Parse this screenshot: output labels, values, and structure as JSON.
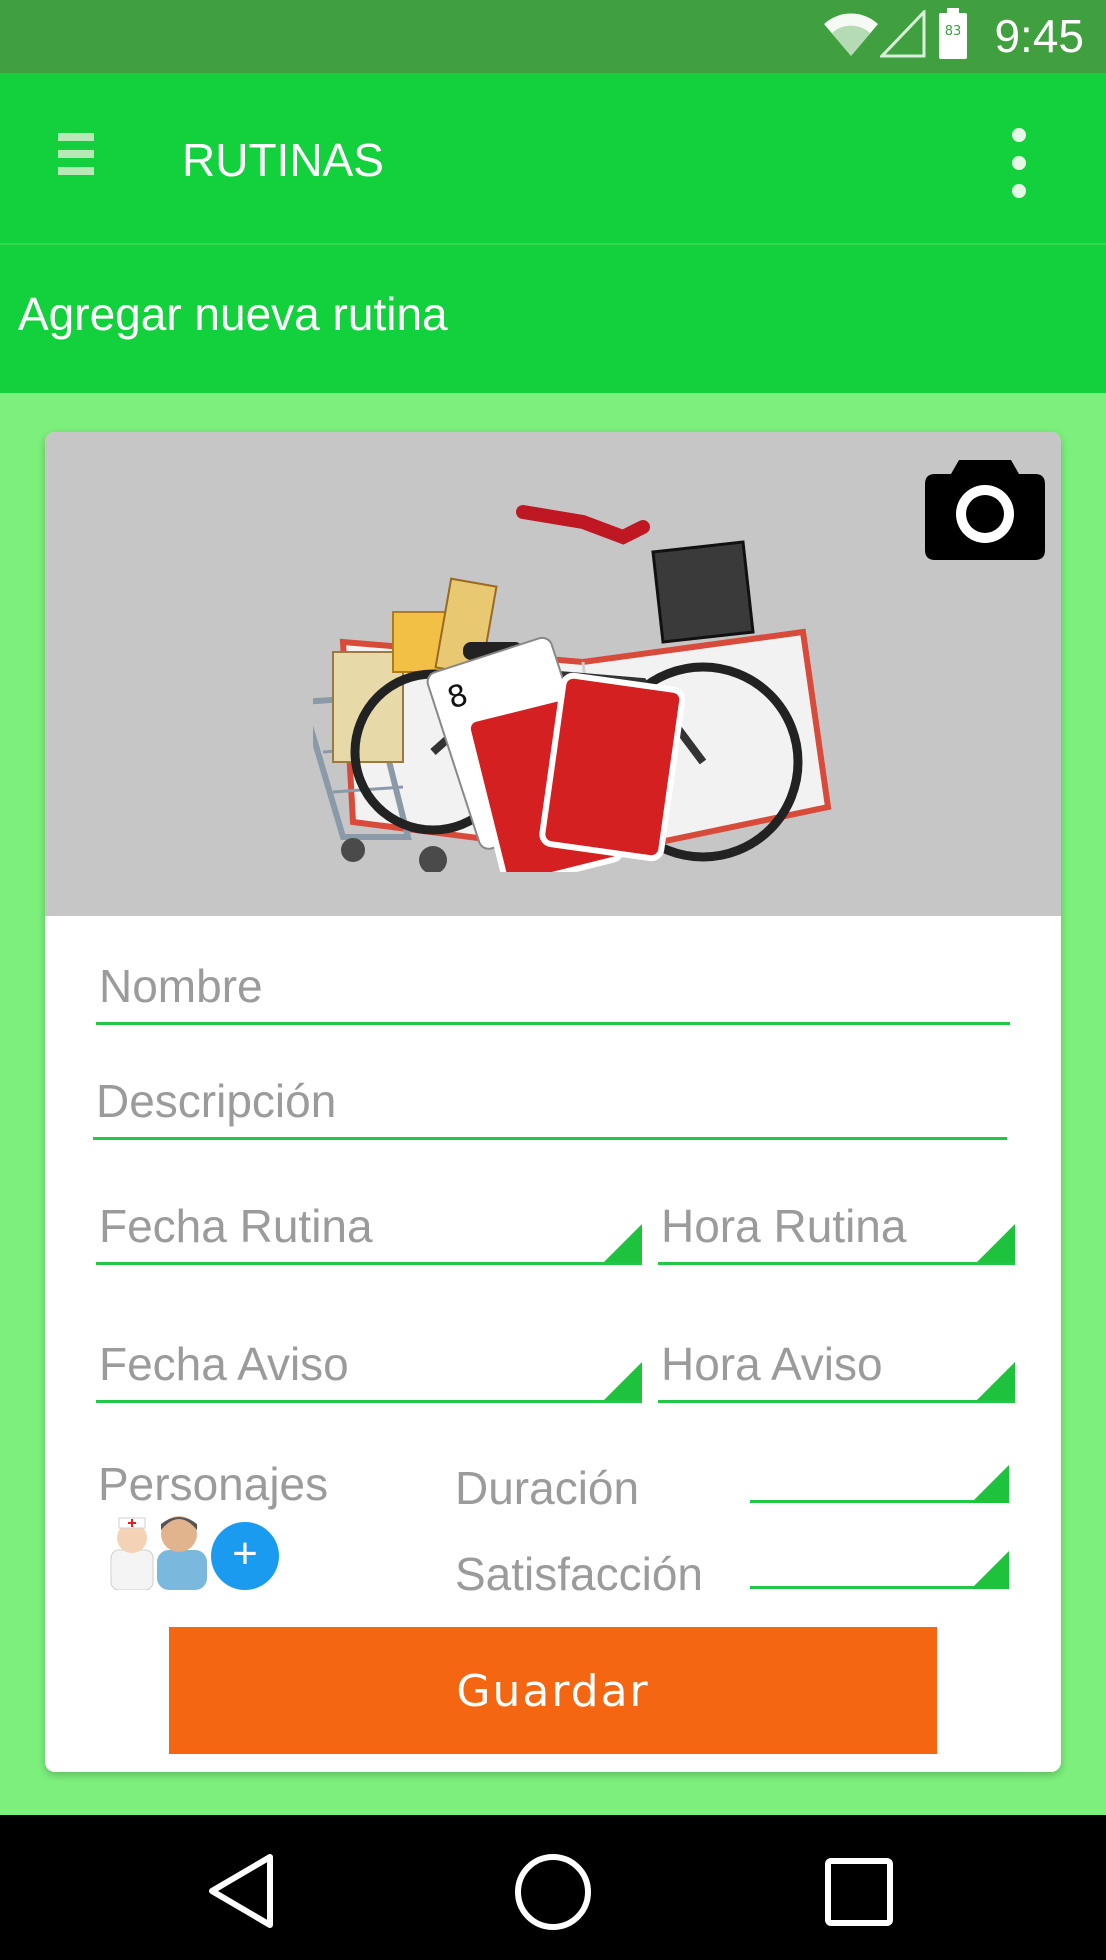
{
  "status_bar": {
    "time": "9:45",
    "battery_level": "83",
    "icons": [
      "wifi-icon",
      "signal-icon",
      "battery-icon"
    ]
  },
  "app_bar": {
    "title": "RUTINAS",
    "menu_icon": "menu-icon",
    "overflow_icon": "more-vert-icon"
  },
  "sub_header": {
    "title": "Agregar nueva rutina"
  },
  "form": {
    "image": {
      "illustration": "routine-illustration",
      "camera_icon": "camera-icon"
    },
    "name_placeholder": "Nombre",
    "description_placeholder": "Descripción",
    "routine_date_placeholder": "Fecha Rutina",
    "routine_time_placeholder": "Hora Rutina",
    "alert_date_placeholder": "Fecha Aviso",
    "alert_time_placeholder": "Hora Aviso",
    "characters_label": "Personajes",
    "characters": [
      "nurse-avatar",
      "patient-avatar"
    ],
    "add_character_label": "+",
    "duration_label": "Duración",
    "satisfaction_label": "Satisfacción",
    "save_label": "Guardar"
  },
  "colors": {
    "app_bar": "#13d13d",
    "background": "#7cef7c",
    "status_bar": "#40a040",
    "accent_line": "#22c845",
    "save_button": "#f46611",
    "add_button": "#1a9bf0",
    "image_bg": "#c6c6c6"
  },
  "nav_bar": {
    "icons": [
      "back-icon",
      "home-icon",
      "recents-icon"
    ]
  }
}
